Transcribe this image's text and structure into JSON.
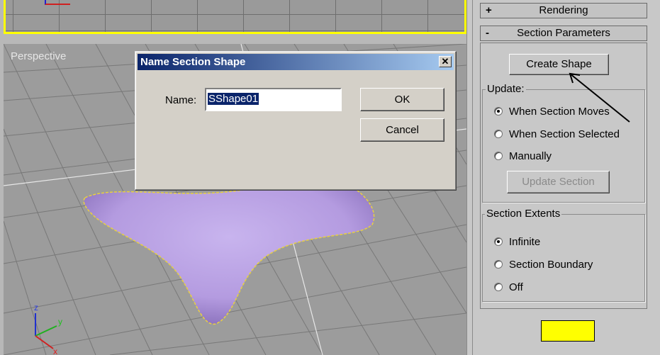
{
  "viewport": {
    "label": "Perspective"
  },
  "command_panel": {
    "rollouts": [
      {
        "sign": "+",
        "title": "Rendering"
      },
      {
        "sign": "-",
        "title": "Section Parameters"
      }
    ],
    "create_shape_label": "Create Shape",
    "update": {
      "label": "Update:",
      "options": [
        "When Section Moves",
        "When Section Selected",
        "Manually"
      ],
      "selected_index": 0,
      "update_section_label": "Update Section"
    },
    "extents": {
      "label": "Section Extents",
      "options": [
        "Infinite",
        "Section Boundary",
        "Off"
      ],
      "selected_index": 0
    },
    "section_color": "#ffff00"
  },
  "dialog": {
    "title": "Name Section Shape",
    "close_glyph": "✕",
    "name_label": "Name:",
    "name_value": "SShape01",
    "ok_label": "OK",
    "cancel_label": "Cancel"
  },
  "colors": {
    "viewport_active": "#ffff00",
    "shape_fill": "#b79ee0",
    "title_bar": "#0a246a"
  }
}
